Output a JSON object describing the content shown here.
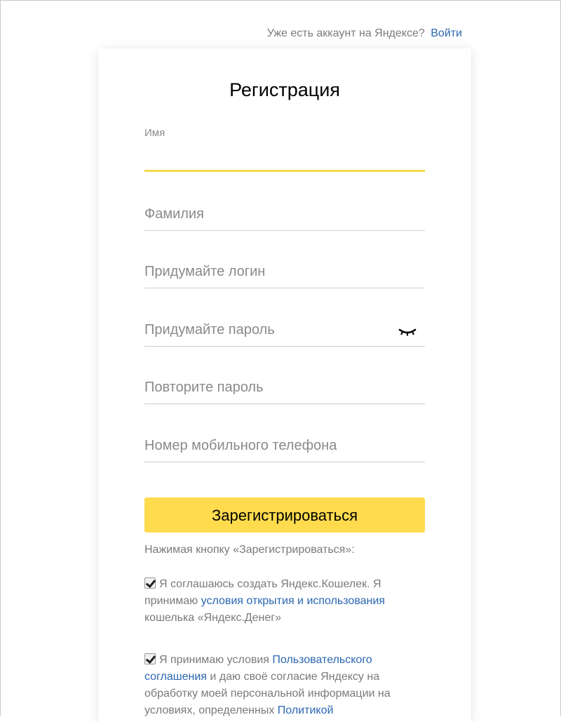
{
  "header": {
    "prompt": "Уже есть аккаунт на Яндексе?",
    "login_link": "Войти"
  },
  "form": {
    "title": "Регистрация",
    "fields": {
      "first_name": {
        "label": "Имя",
        "value": ""
      },
      "last_name": {
        "placeholder": "Фамилия"
      },
      "login": {
        "placeholder": "Придумайте логин"
      },
      "password": {
        "placeholder": "Придумайте пароль",
        "toggle_icon": "eye-closed-icon"
      },
      "password_repeat": {
        "placeholder": "Повторите пароль"
      },
      "phone": {
        "placeholder": "Номер мобильного телефона"
      }
    },
    "submit_label": "Зарегистрироваться",
    "hint": "Нажимая кнопку «Зарегистрироваться»:",
    "agreements": [
      {
        "checked": true,
        "text_before": "Я соглашаюсь создать Яндекс.Кошелек. Я принимаю ",
        "link": "условия открытия и использования",
        "text_after": " кошелька «Яндекс.Денег»"
      },
      {
        "checked": true,
        "text_before": "Я принимаю условия ",
        "link": "Пользовательского соглашения",
        "text_after": " и даю своё согласие Яндексу на обработку моей персональной информации на условиях, определенных ",
        "link2": "Политикой"
      }
    ]
  },
  "colors": {
    "accent_yellow": "#ffdb4d",
    "link_blue": "#2a67b1",
    "placeholder_gray": "#8a8a8a"
  }
}
